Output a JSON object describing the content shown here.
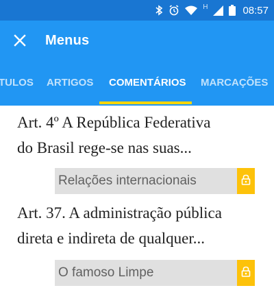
{
  "status_bar": {
    "time": "08:57",
    "network_label": "H",
    "icons": [
      "bluetooth-icon",
      "alarm-icon",
      "wifi-icon",
      "signal-icon",
      "battery-icon"
    ]
  },
  "app_bar": {
    "title": "Menus",
    "close_icon": "close-icon"
  },
  "tabs": [
    {
      "label": "TÍTULOS",
      "visible_label": "TULOS",
      "active": false
    },
    {
      "label": "ARTIGOS",
      "active": false
    },
    {
      "label": "COMENTÁRIOS",
      "active": true
    },
    {
      "label": "MARCAÇÕES",
      "active": false
    }
  ],
  "items": [
    {
      "article_line1": "Art. 4º A República Federativa",
      "article_line2": "do Brasil rege-se nas suas...",
      "comment": "Relações internacionais",
      "lock_icon": "lock-icon"
    },
    {
      "article_line1": "Art. 37. A administração pública",
      "article_line2": "direta e indireta de qualquer...",
      "comment": "O famoso Limpe",
      "lock_icon": "lock-icon"
    }
  ],
  "colors": {
    "status_bar": "#1976d2",
    "app_bar": "#2196f3",
    "tab_indicator": "#ffd600",
    "lock_badge": "#fdc20a",
    "comment_bg": "#e0e0e0"
  }
}
